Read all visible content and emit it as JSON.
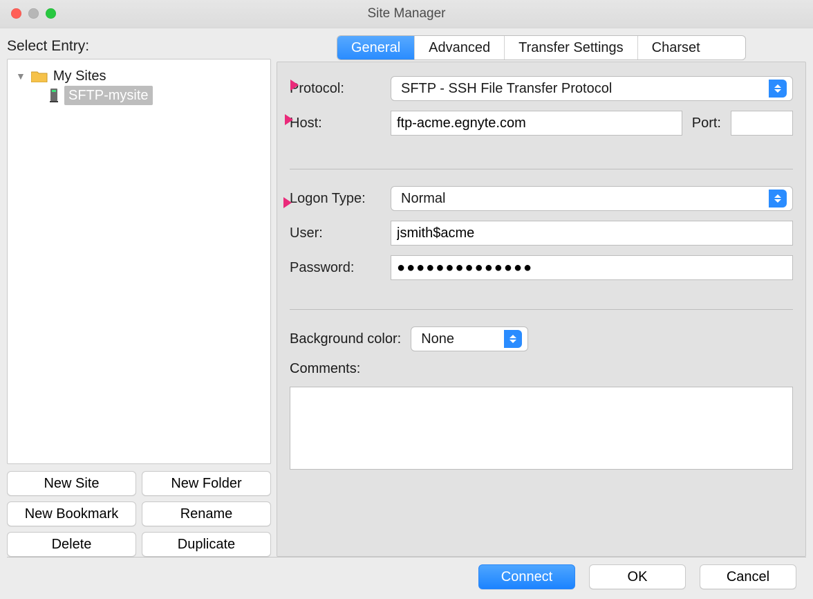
{
  "window": {
    "title": "Site Manager"
  },
  "left": {
    "heading": "Select Entry:",
    "folder_label": "My Sites",
    "site_label": "SFTP-mysite",
    "buttons": {
      "new_site": "New Site",
      "new_folder": "New Folder",
      "new_bookmark": "New Bookmark",
      "rename": "Rename",
      "delete": "Delete",
      "duplicate": "Duplicate"
    }
  },
  "tabs": {
    "general": "General",
    "advanced": "Advanced",
    "transfer": "Transfer Settings",
    "charset": "Charset"
  },
  "form": {
    "protocol_label": "Protocol:",
    "protocol_value": "SFTP - SSH File Transfer Protocol",
    "host_label": "Host:",
    "host_value": "ftp-acme.egnyte.com",
    "port_label": "Port:",
    "port_value": "",
    "logon_type_label": "Logon Type:",
    "logon_type_value": "Normal",
    "user_label": "User:",
    "user_value": "jsmith$acme",
    "password_label": "Password:",
    "password_value": "●●●●●●●●●●●●●●",
    "bgcolor_label": "Background color:",
    "bgcolor_value": "None",
    "comments_label": "Comments:",
    "comments_value": ""
  },
  "footer": {
    "connect": "Connect",
    "ok": "OK",
    "cancel": "Cancel"
  },
  "annotation": {
    "arrow_color": "#ea2a7a"
  }
}
